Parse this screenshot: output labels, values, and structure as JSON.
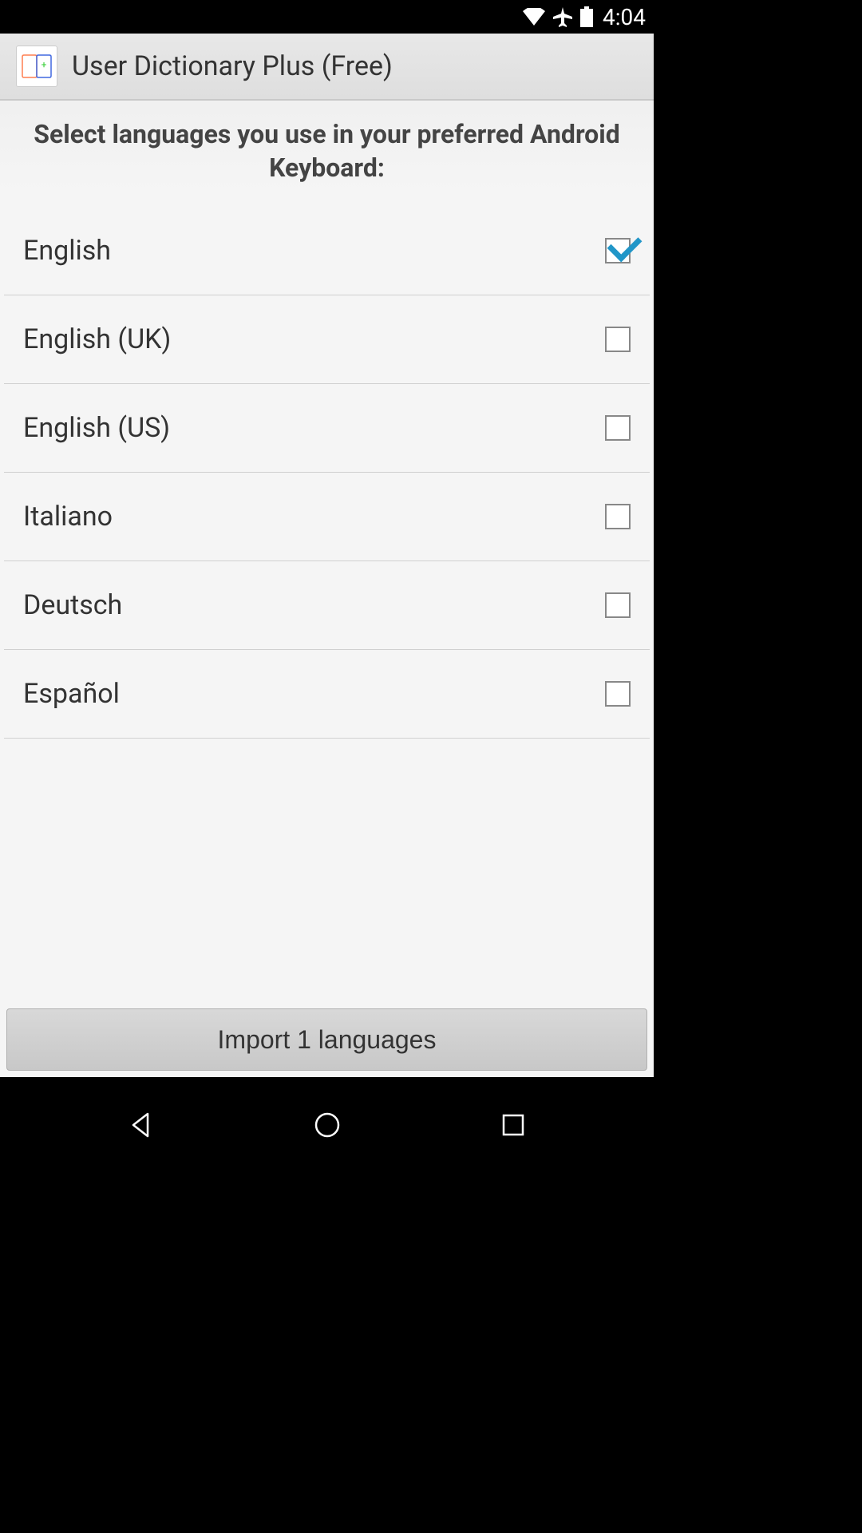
{
  "status": {
    "time": "4:04"
  },
  "app": {
    "title": "User Dictionary Plus (Free)",
    "instruction": "Select languages you use in your preferred Android Keyboard:"
  },
  "languages": [
    {
      "label": "English",
      "checked": true
    },
    {
      "label": "English (UK)",
      "checked": false
    },
    {
      "label": "English (US)",
      "checked": false
    },
    {
      "label": "Italiano",
      "checked": false
    },
    {
      "label": "Deutsch",
      "checked": false
    },
    {
      "label": "Español",
      "checked": false
    }
  ],
  "button": {
    "import_label": "Import 1 languages"
  }
}
